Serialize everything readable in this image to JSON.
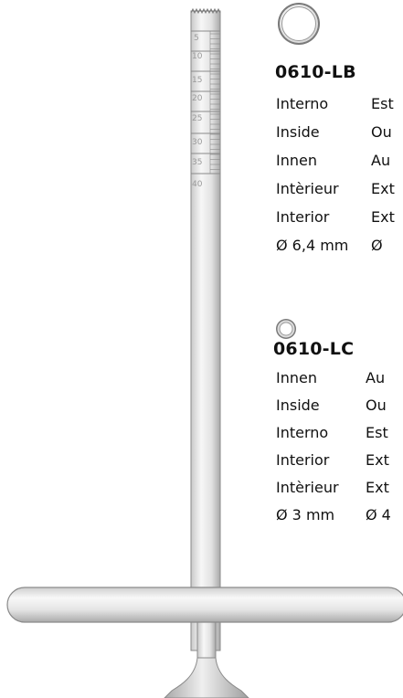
{
  "ruler": {
    "marks": [
      "5",
      "10",
      "15",
      "20",
      "25",
      "30",
      "35",
      "40"
    ]
  },
  "product_lb": {
    "code": "0610-LB",
    "inner": [
      "Interno",
      "Inside",
      "Innen",
      "Intèrieur",
      "Interior",
      "Ø 6,4 mm"
    ],
    "outer": [
      "Est",
      "Ou",
      "Au",
      "Ext",
      "Ext",
      "Ø"
    ]
  },
  "product_lc": {
    "code": "0610-LC",
    "inner": [
      "Innen",
      "Inside",
      "Interno",
      "Interior",
      "Intèrieur",
      "Ø 3 mm"
    ],
    "outer": [
      "Au",
      "Ou",
      "Est",
      "Ext",
      "Ext",
      "Ø 4"
    ]
  },
  "colors": {
    "metal_light": "#f3f3f3",
    "metal_dark": "#b5b5b5",
    "outline": "#8a8a8a",
    "text": "#111111"
  }
}
